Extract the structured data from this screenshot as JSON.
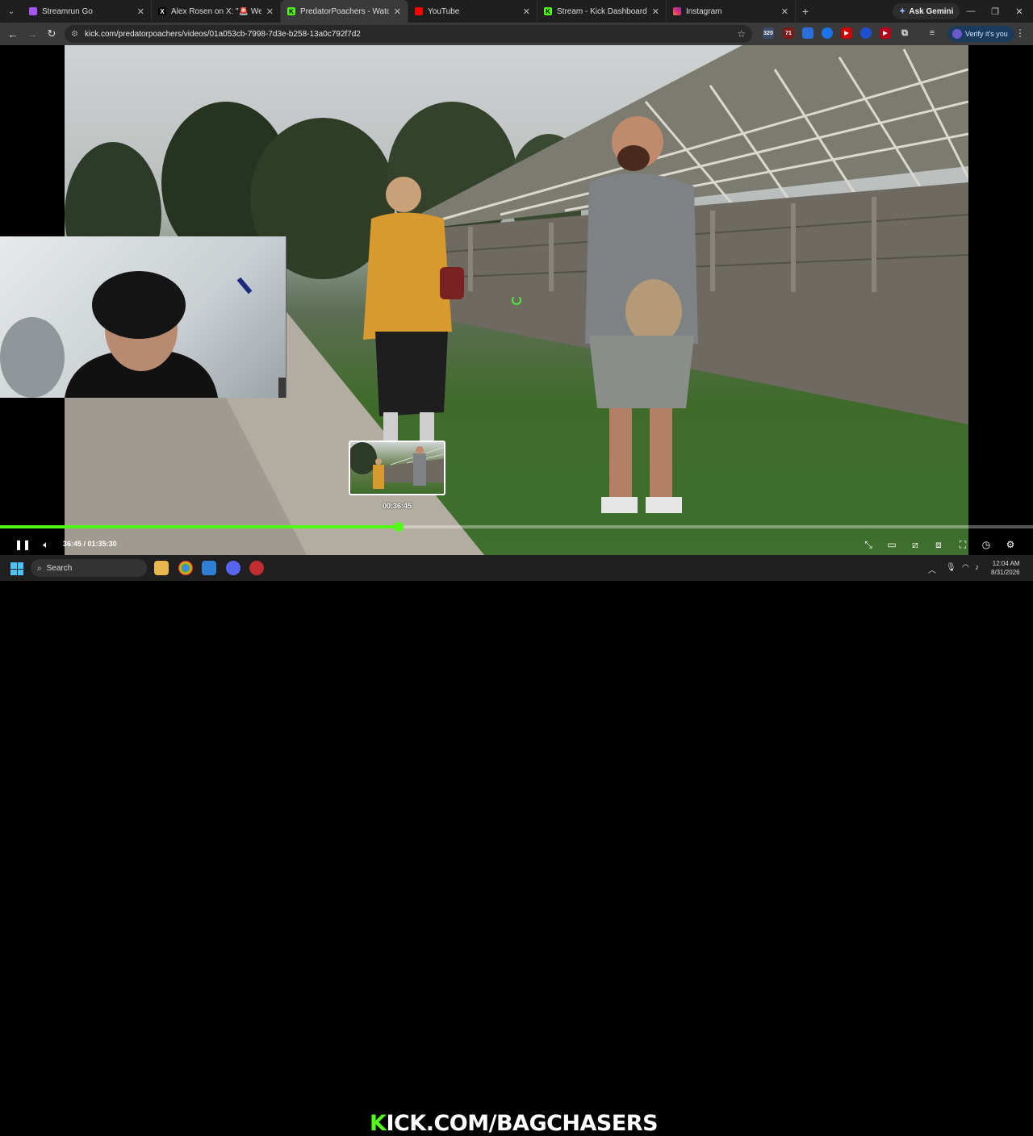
{
  "browser": {
    "tabs": [
      {
        "title": "Streamrun Go",
        "favicon_color": "#a855f7",
        "active": false
      },
      {
        "title": "Alex Rosen on X: \"🚨 We're LIVE",
        "favicon_color": "#000000",
        "active": false
      },
      {
        "title": "PredatorPoachers - Watch",
        "favicon_color": "#53fc18",
        "active": true
      },
      {
        "title": "YouTube",
        "favicon_color": "#ff0000",
        "active": false
      },
      {
        "title": "Stream - Kick Dashboard",
        "favicon_color": "#53fc18",
        "active": false
      },
      {
        "title": "Instagram",
        "favicon_color": "#e1306c",
        "active": false
      }
    ],
    "new_tab": "+",
    "ask_gemini": "Ask Gemini",
    "url": "kick.com/predatorpoachers/videos/01a053cb-7998-7d3e-b258-13a0c792f7d2",
    "verify_label": "Verify it's you",
    "extensions": [
      {
        "icon": "ext-320-icon",
        "label": "320",
        "color": "#3b4b6b"
      },
      {
        "icon": "ext-71-icon",
        "label": "71",
        "color": "#7a1b1b"
      },
      {
        "icon": "ext-shield-icon",
        "label": "",
        "color": "#2a6fdb"
      },
      {
        "icon": "ext-blue-icon",
        "label": "",
        "color": "#1a73e8"
      },
      {
        "icon": "ext-youtube-icon",
        "label": "",
        "color": "#cc0000"
      },
      {
        "icon": "ext-circle-icon",
        "label": "",
        "color": "#1f4fd1"
      },
      {
        "icon": "ext-red-icon",
        "label": "",
        "color": "#b3001b"
      }
    ]
  },
  "player": {
    "preview_time": "00:36:45",
    "current_time": "36:45",
    "separator": " / ",
    "duration": "01:35:30",
    "progress_fraction": 0.386,
    "accent": "#53fc18"
  },
  "taskbar": {
    "search_placeholder": "Search",
    "banner_k": "K",
    "banner_rest": "ICK.COM/BAGCHASERS",
    "time": "12:04 AM",
    "date": "8/31/2026"
  }
}
